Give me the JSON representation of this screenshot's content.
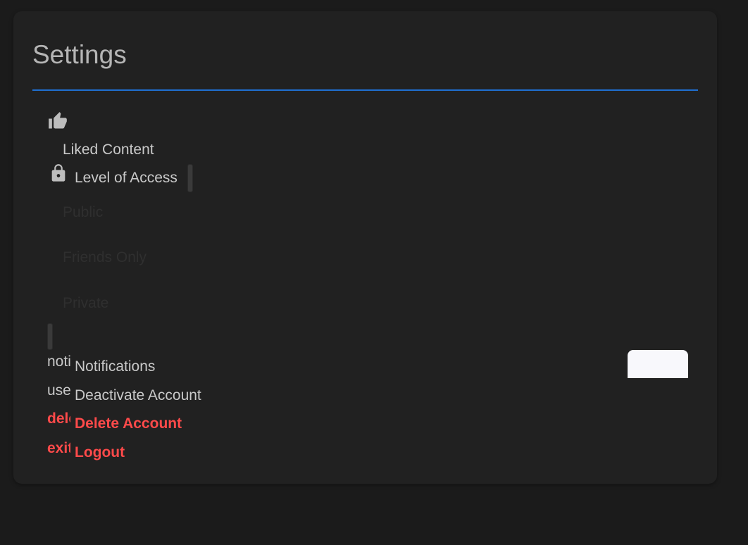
{
  "header": {
    "title": "Settings"
  },
  "liked": {
    "label": "Liked Content",
    "icon": "thumbs-up-icon"
  },
  "access": {
    "label": "Level of Access",
    "icon": "lock-icon",
    "options": [
      "Public",
      "Friends Only",
      "Private"
    ]
  },
  "actions": [
    {
      "key_text": "notifications",
      "label": "Notifications",
      "danger": false
    },
    {
      "key_text": "user",
      "label": "Deactivate Account",
      "danger": false
    },
    {
      "key_text": "delete",
      "label": "Delete Account",
      "danger": true
    },
    {
      "key_text": "exit",
      "label": "Logout",
      "danger": true
    }
  ],
  "colors": {
    "background": "#1b1b1b",
    "card": "#212121",
    "divider": "#1f6fd1",
    "text": "#c9c9c9",
    "danger": "#ff4a4a"
  }
}
